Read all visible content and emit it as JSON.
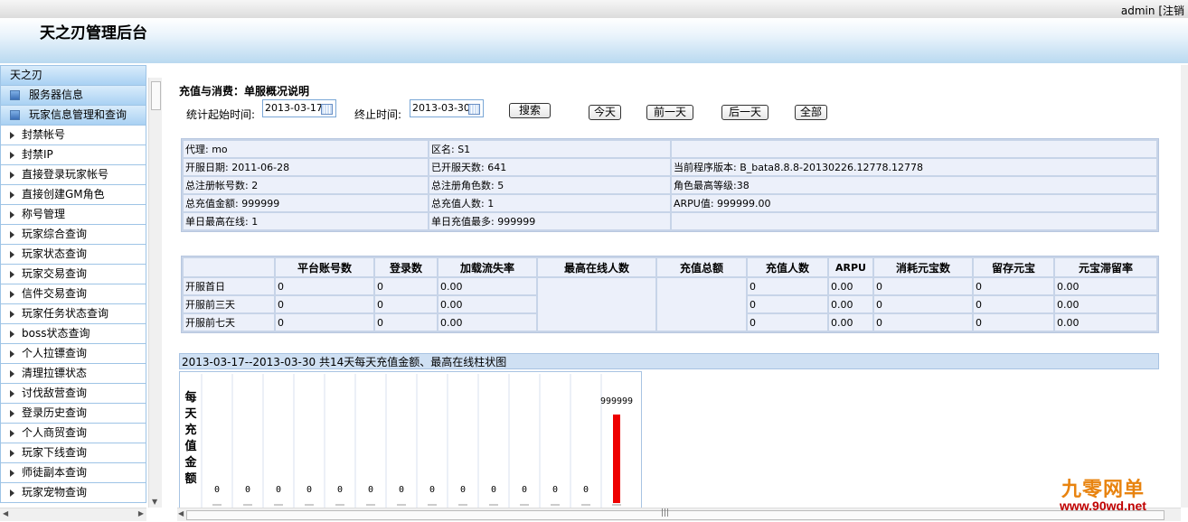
{
  "topbar": {
    "user": "admin",
    "logout": "[注销"
  },
  "header": {
    "title": "天之刃管理后台"
  },
  "sidebar": {
    "root": "天之刃",
    "categories": [
      "服务器信息",
      "玩家信息管理和查询"
    ],
    "items": [
      "封禁帐号",
      "封禁IP",
      "直接登录玩家帐号",
      "直接创建GM角色",
      "称号管理",
      "玩家综合查询",
      "玩家状态查询",
      "玩家交易查询",
      "信件交易查询",
      "玩家任务状态查询",
      "boss状态查询",
      "个人拉镖查询",
      "清理拉镖状态",
      "讨伐敌营查询",
      "登录历史查询",
      "个人商贸查询",
      "玩家下线查询",
      "师徒副本查询",
      "玩家宠物查询"
    ]
  },
  "page": {
    "title": "充值与消费：单服概况说明",
    "start_label": "统计起始时间:",
    "start_value": "2013-03-17",
    "end_label": "终止时间:",
    "end_value": "2013-03-30",
    "buttons": {
      "search": "搜索",
      "today": "今天",
      "prev": "前一天",
      "next": "后一天",
      "all": "全部"
    }
  },
  "info": {
    "agent": "代理: mo",
    "zone": "区名: S1",
    "open_date": "开服日期: 2011-06-28",
    "open_days": "已开服天数: 641",
    "version": "当前程序版本: B_bata8.8.8-20130226.12778.12778",
    "reg_accounts": "总注册帐号数: 2",
    "reg_roles": "总注册角色数: 5",
    "max_level": "角色最高等级:38",
    "total_pay": "总充值金额: 999999",
    "pay_users": "总充值人数: 1",
    "arpu": "ARPU值: 999999.00",
    "max_online": "单日最高在线: 1",
    "max_pay": "单日充值最多: 999999"
  },
  "stats": {
    "headers": [
      "",
      "平台账号数",
      "登录数",
      "加载流失率",
      "最高在线人数",
      "充值总额",
      "充值人数",
      "ARPU",
      "消耗元宝数",
      "留存元宝",
      "元宝滞留率"
    ],
    "rows": [
      {
        "label": "开服首日",
        "accounts": "0",
        "logins": "0",
        "loss": "0.00",
        "pay_users": "0",
        "arpu": "0.00",
        "spent": "0",
        "kept": "0",
        "ratio": "0.00"
      },
      {
        "label": "开服前三天",
        "accounts": "0",
        "logins": "0",
        "loss": "0.00",
        "pay_users": "0",
        "arpu": "0.00",
        "spent": "0",
        "kept": "0",
        "ratio": "0.00"
      },
      {
        "label": "开服前七天",
        "accounts": "0",
        "logins": "0",
        "loss": "0.00",
        "pay_users": "0",
        "arpu": "0.00",
        "spent": "0",
        "kept": "0",
        "ratio": "0.00"
      }
    ]
  },
  "chart_header": "2013-03-17--2013-03-30 共14天每天充值金额、最高在线柱状图",
  "chart_data": {
    "type": "bar",
    "ylabel": "每天充值金额",
    "values": [
      0,
      0,
      0,
      0,
      0,
      0,
      0,
      0,
      0,
      0,
      0,
      0,
      0,
      999999
    ],
    "labels": [
      "0",
      "0",
      "0",
      "0",
      "0",
      "0",
      "0",
      "0",
      "0",
      "0",
      "0",
      "0",
      "0",
      "999999"
    ],
    "bar_color": "#ee0000"
  },
  "watermark": {
    "cn": "九零网单",
    "url": "www.90wd.net"
  }
}
